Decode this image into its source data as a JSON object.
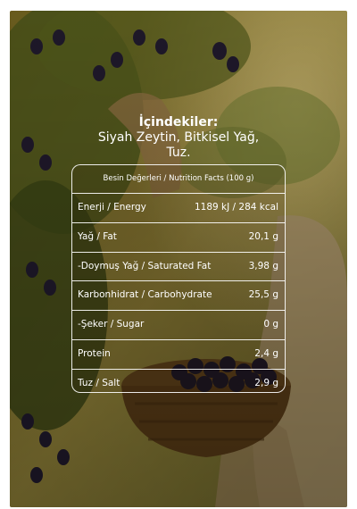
{
  "ingredients": {
    "title": "İçindekiler:",
    "text": "Siyah Zeytin, Bitkisel Yağ, Tuz."
  },
  "nutrition": {
    "header": "Besin Değerleri / Nutrition Facts (100 g)",
    "rows": [
      {
        "label": "Enerji / Energy",
        "value": "1189 kJ / 284 kcal"
      },
      {
        "label": "Yağ / Fat",
        "value": "20,1 g"
      },
      {
        "label": "-Doymuş Yağ / Saturated Fat",
        "value": "3,98 g"
      },
      {
        "label": "Karbonhidrat / Carbohydrate",
        "value": "25,5 g"
      },
      {
        "label": "-Şeker / Sugar",
        "value": "0 g"
      },
      {
        "label": "Protein",
        "value": "2,4 g"
      },
      {
        "label": "Tuz / Salt",
        "value": "2,9 g"
      }
    ]
  }
}
